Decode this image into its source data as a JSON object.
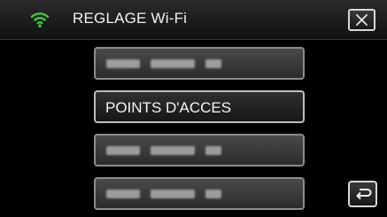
{
  "header": {
    "title": "REGLAGE Wi-Fi",
    "wifi_icon": "wifi-icon",
    "close_icon": "close-icon",
    "accent_color": "#3fbf3f"
  },
  "menu": {
    "items": [
      {
        "label": "",
        "obscured": true
      },
      {
        "label": "POINTS D'ACCES",
        "obscured": false
      },
      {
        "label": "",
        "obscured": true
      },
      {
        "label": "",
        "obscured": true
      }
    ]
  },
  "footer": {
    "back_icon": "return-arrow-icon"
  }
}
